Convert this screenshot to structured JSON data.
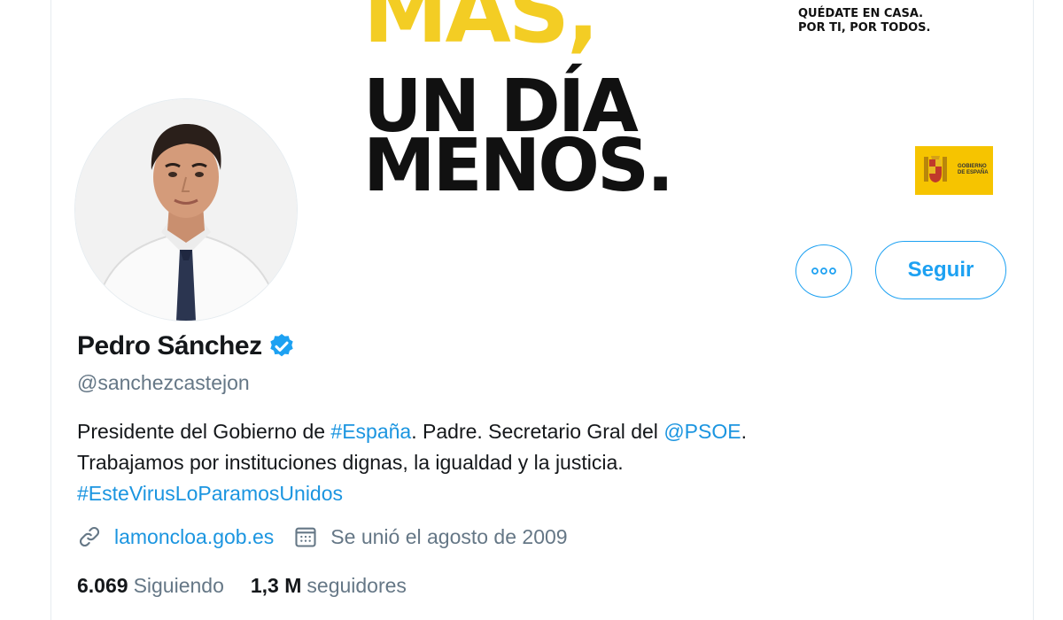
{
  "banner": {
    "headline_line1": "MÁS,",
    "headline_line2": "UN DÍA",
    "headline_line3": "MENOS.",
    "campaign_line1": "QUÉDATE EN CASA.",
    "campaign_line2": "POR TI, POR TODOS.",
    "gov_logo_line1": "GOBIERNO",
    "gov_logo_line2": "DE ESPAÑA",
    "accent_color": "#f3cd24"
  },
  "actions": {
    "more_label": "•••",
    "follow_label": "Seguir"
  },
  "profile": {
    "name": "Pedro Sánchez",
    "handle": "@sanchezcastejon",
    "bio": {
      "text1": "Presidente del Gobierno de ",
      "hashtag1": "#España",
      "text2": ". Padre. Secretario Gral del ",
      "mention": "@PSOE",
      "text3": ".",
      "line2": "Trabajamos por instituciones dignas, la igualdad y la justicia.",
      "hashtag2": "#EsteVirusLoParamosUnidos"
    },
    "website": "lamoncloa.gob.es",
    "joined": "Se unió el agosto de 2009",
    "link_color": "#1b95e0"
  },
  "stats": {
    "following_count": "6.069",
    "following_label": "Siguiendo",
    "followers_count": "1,3 M",
    "followers_label": "seguidores"
  },
  "icons": {
    "verified": "verified-badge-icon",
    "link": "link-icon",
    "calendar": "calendar-icon"
  }
}
